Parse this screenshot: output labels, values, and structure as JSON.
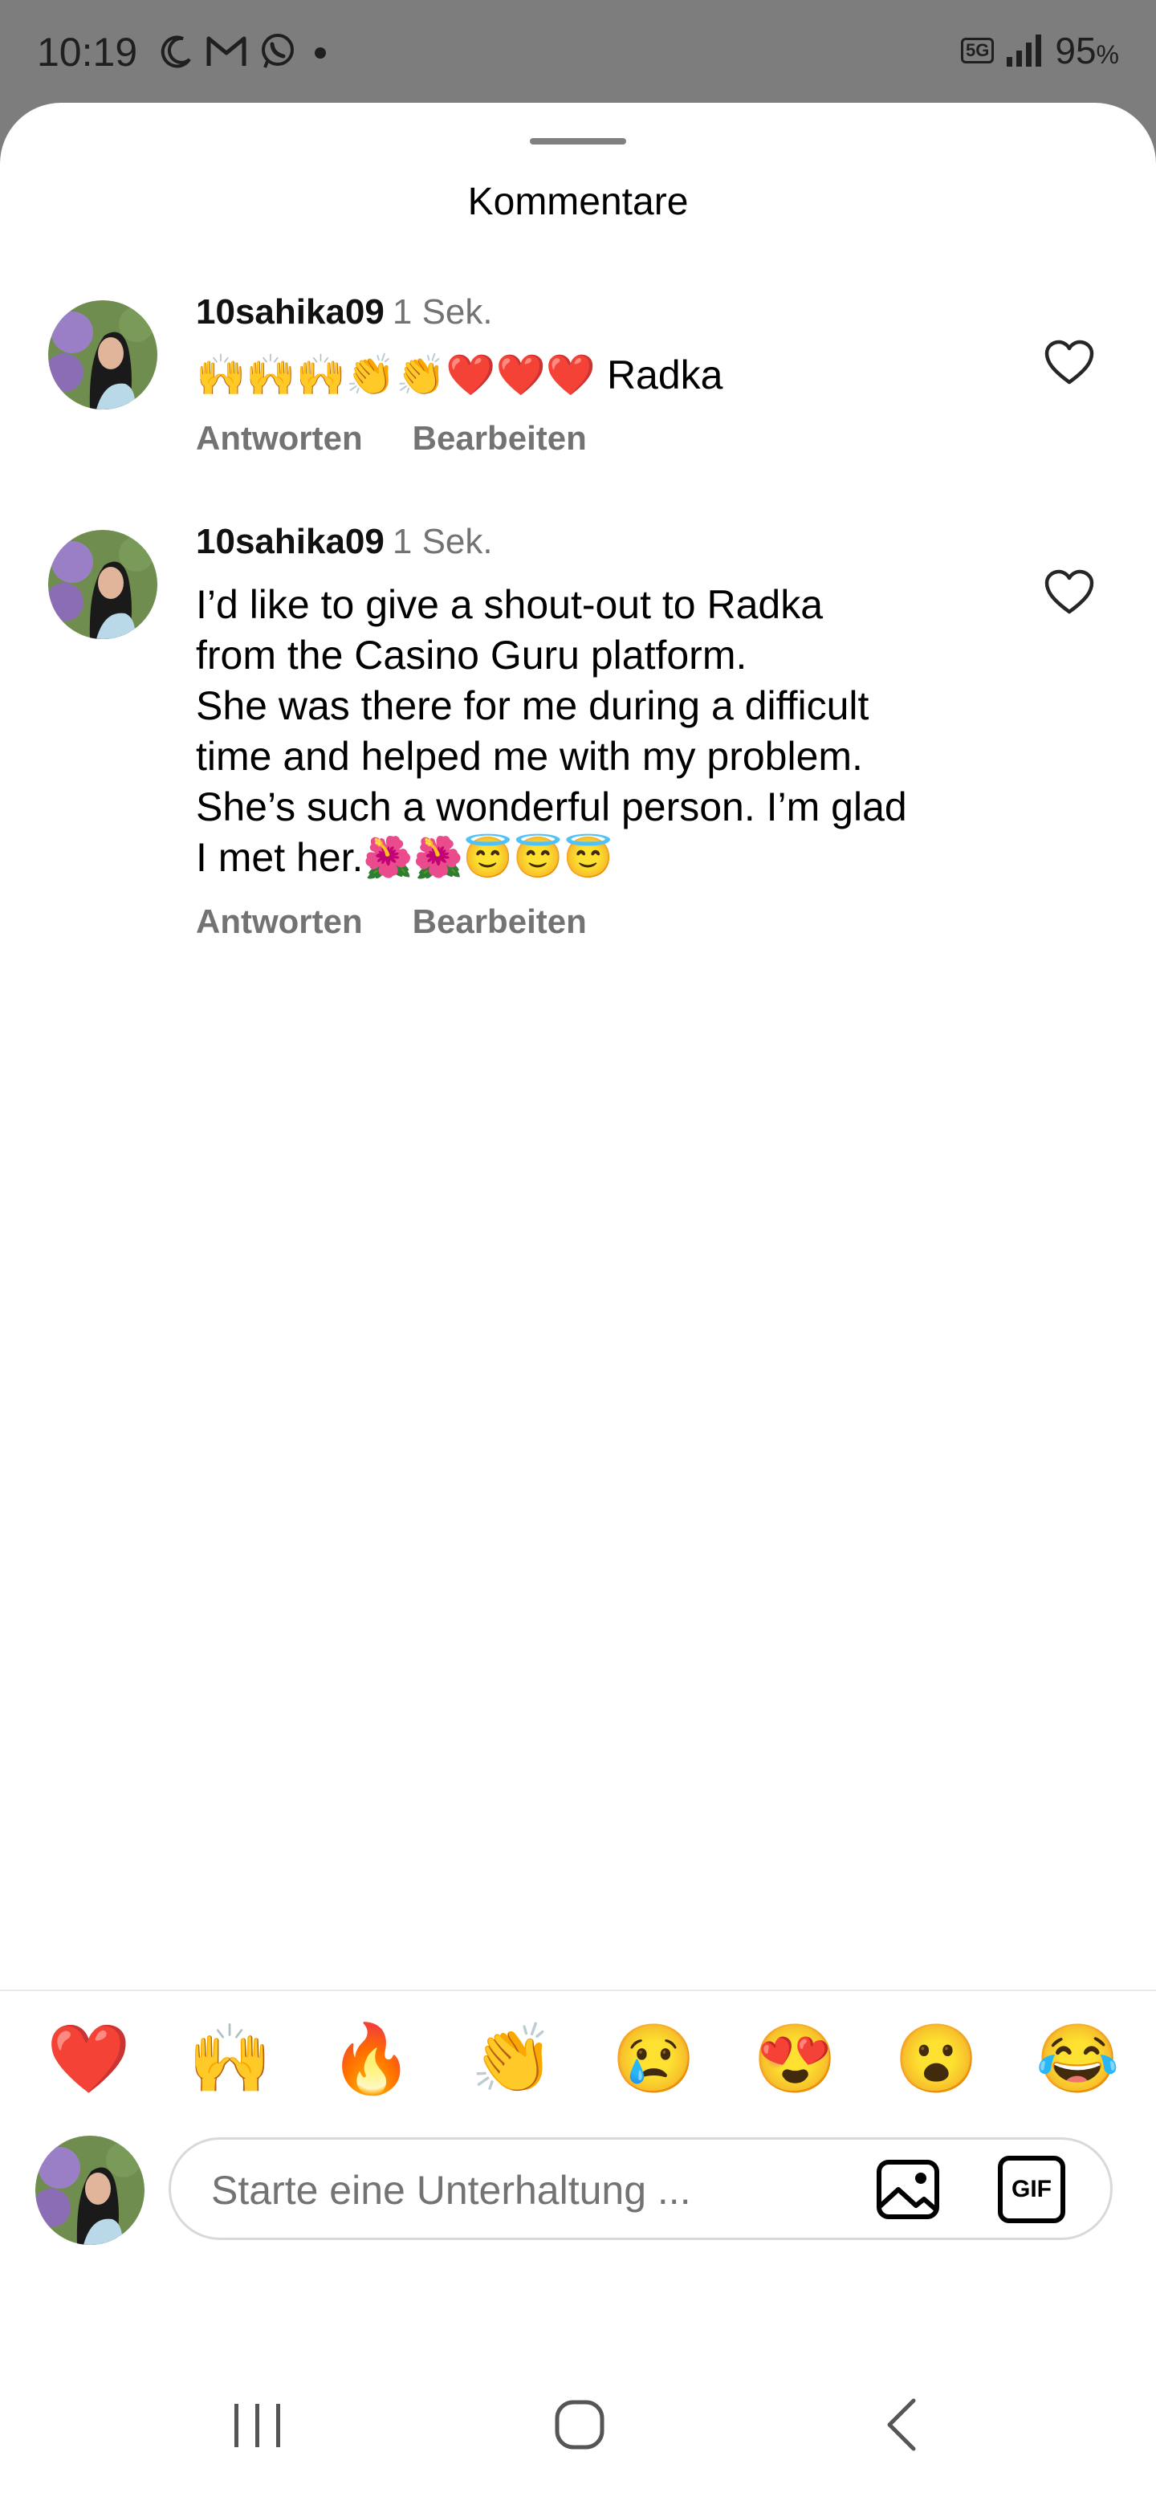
{
  "status_bar": {
    "time": "10:19",
    "icons": [
      "moon-icon",
      "gmail-icon",
      "whatsapp-icon",
      "dot-icon"
    ],
    "network": "5G",
    "battery_value": "95",
    "battery_unit": "%"
  },
  "sheet": {
    "title": "Kommentare"
  },
  "comments": [
    {
      "username": "10sahika09",
      "time": "1 Sek.",
      "text": "🙌🙌🙌👏👏❤️❤️❤️ Radka",
      "reply_label": "Antworten",
      "edit_label": "Bearbeiten"
    },
    {
      "username": "10sahika09",
      "time": "1 Sek.",
      "text": "I’d like to give a shout-out to Radka\nfrom the Casino Guru platform.\nShe was there for me during a difficult\ntime and helped me with my problem.\nShe’s such a wonderful person. I’m glad\nI met her.🌺🌺😇😇😇",
      "reply_label": "Antworten",
      "edit_label": "Bearbeiten"
    }
  ],
  "quick_emojis": [
    "❤️",
    "🙌",
    "🔥",
    "👏",
    "😢",
    "😍",
    "😮",
    "😂"
  ],
  "composer": {
    "placeholder": "Starte eine Unterhaltung ...",
    "gif_label": "GIF"
  },
  "colors": {
    "status_bar_bg": "#7d7d7d",
    "secondary_text": "#737373",
    "like_outline": "#262626"
  }
}
